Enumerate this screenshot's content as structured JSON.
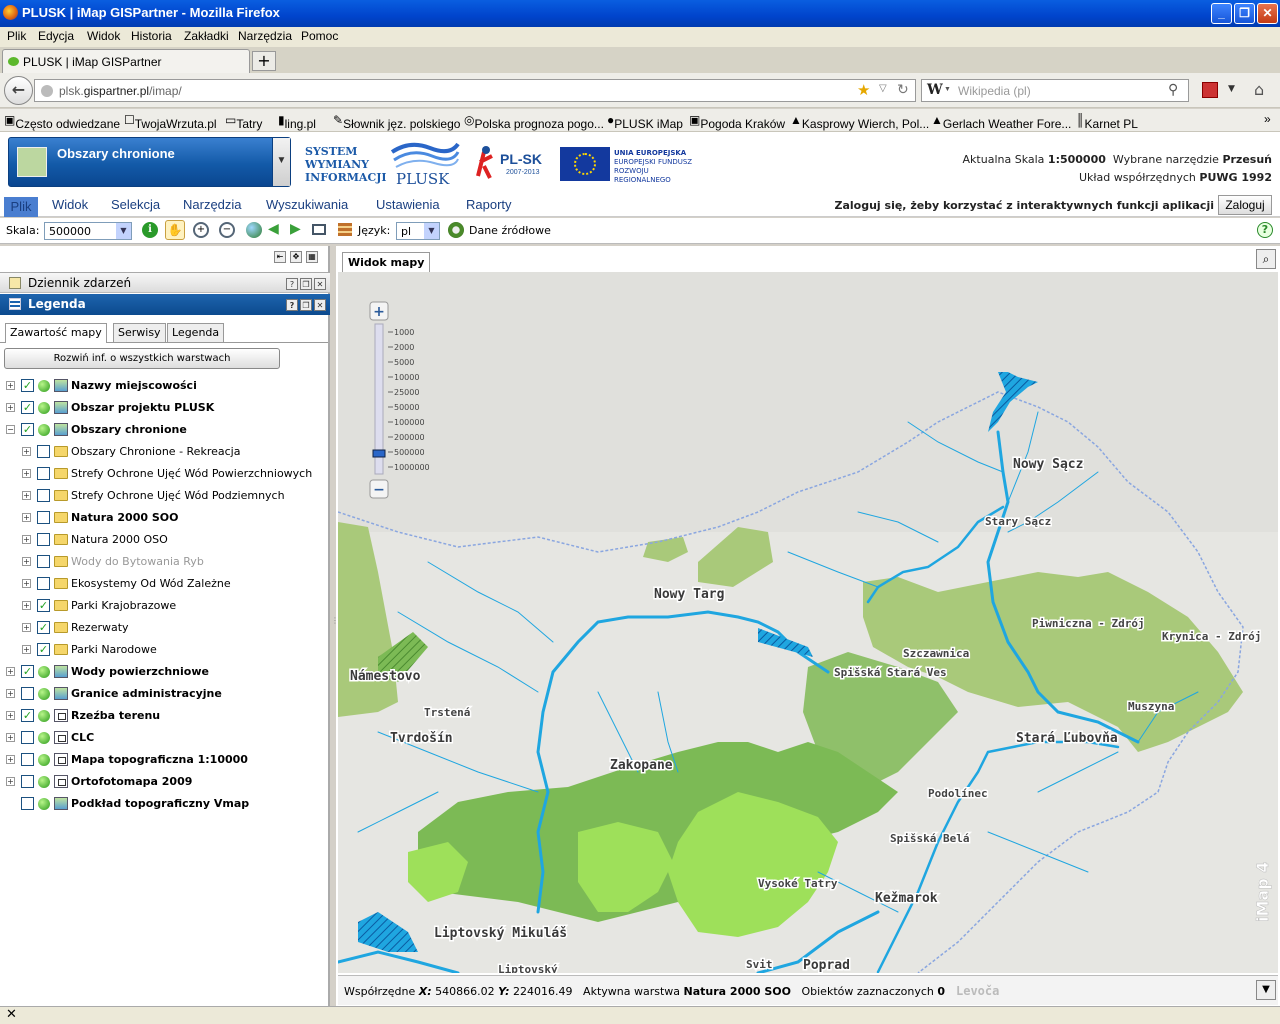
{
  "window": {
    "title": "PLUSK | iMap GISPartner - Mozilla Firefox",
    "controls": {
      "minimize": "_",
      "maximize": "❐",
      "close": "✕"
    }
  },
  "menubar": [
    "Plik",
    "Edycja",
    "Widok",
    "Historia",
    "Zakładki",
    "Narzędzia",
    "Pomoc"
  ],
  "browser_tab": {
    "label": "PLUSK | iMap GISPartner",
    "new_tab": "+"
  },
  "nav": {
    "url_host": "plsk.",
    "url_domain": "gispartner.pl",
    "url_path": "/imap/",
    "search_placeholder": "Wikipedia (pl)"
  },
  "bookmarks": [
    "Często odwiedzane",
    "TwojaWrzuta.pl",
    "Tatry",
    "ling.pl",
    "Słownik jęz. polskiego",
    "Polska prognoza pogo...",
    "PLUSK iMap",
    "Pogoda Kraków",
    "Kasprowy Wierch, Pol...",
    "Gerlach Weather Fore...",
    "Karnet PL"
  ],
  "app": {
    "area_selector": "Obszary chronione",
    "system_name": [
      "SYSTEM",
      "WYMIANY",
      "INFORMACJI"
    ],
    "plusk_logo_text": "PLUSK",
    "plsk_logo_text": "PL-SK",
    "plsk_years": "2007-2013",
    "eu_text": [
      "UNIA EUROPEJSKA",
      "EUROPEJSKI FUNDUSZ",
      "ROZWOJU REGIONALNEGO"
    ],
    "scale_label": "Aktualna Skala",
    "scale_value": "1:500000",
    "tool_label": "Wybrane narzędzie",
    "tool_value": "Przesuń",
    "crs_label": "Układ współrzędnych",
    "crs_value": "PUWG 1992"
  },
  "appmenu": [
    "Plik",
    "Widok",
    "Selekcja",
    "Narzędzia",
    "Wyszukiwania",
    "Ustawienia",
    "Raporty"
  ],
  "login": {
    "message": "Zaloguj się, żeby korzystać z interaktywnych funkcji aplikacji",
    "button": "Zaloguj"
  },
  "toolbar": {
    "scale_label": "Skala:",
    "scale_value": "500000",
    "lang_label": "Język:",
    "lang_value": "pl",
    "source_label": "Dane źródłowe"
  },
  "left_panel": {
    "events_title": "Dziennik zdarzeń",
    "legend_title": "Legenda",
    "subtabs": [
      "Zawartość mapy",
      "Serwisy",
      "Legenda"
    ],
    "expand_all": "Rozwiń inf. o wszystkich warstwach",
    "layers": [
      {
        "label": "Nazwy miejscowości",
        "checked": true,
        "bold": true,
        "level": 0,
        "icon": "layer"
      },
      {
        "label": "Obszar projektu PLUSK",
        "checked": true,
        "bold": true,
        "level": 0,
        "icon": "layer"
      },
      {
        "label": "Obszary chronione",
        "checked": true,
        "bold": true,
        "level": 0,
        "icon": "layer",
        "expanded": true
      },
      {
        "label": "Obszary Chronione - Rekreacja",
        "checked": false,
        "bold": false,
        "level": 1,
        "icon": "folder"
      },
      {
        "label": "Strefy Ochrone Ujęć Wód Powierzchniowych",
        "checked": false,
        "bold": false,
        "level": 1,
        "icon": "folder"
      },
      {
        "label": "Strefy Ochrone Ujęć Wód Podziemnych",
        "checked": false,
        "bold": false,
        "level": 1,
        "icon": "folder"
      },
      {
        "label": "Natura 2000 SOO",
        "checked": false,
        "bold": true,
        "level": 1,
        "icon": "folder"
      },
      {
        "label": "Natura 2000 OSO",
        "checked": false,
        "bold": false,
        "level": 1,
        "icon": "folder"
      },
      {
        "label": "Wody do Bytowania Ryb",
        "checked": false,
        "bold": false,
        "level": 1,
        "icon": "folder",
        "dim": true
      },
      {
        "label": "Ekosystemy Od Wód Zależne",
        "checked": false,
        "bold": false,
        "level": 1,
        "icon": "folder"
      },
      {
        "label": "Parki Krajobrazowe",
        "checked": true,
        "bold": false,
        "level": 1,
        "icon": "folder"
      },
      {
        "label": "Rezerwaty",
        "checked": true,
        "bold": false,
        "level": 1,
        "icon": "folder"
      },
      {
        "label": "Parki Narodowe",
        "checked": true,
        "bold": false,
        "level": 1,
        "icon": "folder"
      },
      {
        "label": "Wody powierzchniowe",
        "checked": true,
        "bold": true,
        "level": 0,
        "icon": "layer"
      },
      {
        "label": "Granice administracyjne",
        "checked": false,
        "bold": true,
        "level": 0,
        "icon": "layer"
      },
      {
        "label": "Rzeźba terenu",
        "checked": true,
        "bold": true,
        "level": 0,
        "icon": "grid"
      },
      {
        "label": "CLC",
        "checked": false,
        "bold": true,
        "level": 0,
        "icon": "grid"
      },
      {
        "label": "Mapa topograficzna 1:10000",
        "checked": false,
        "bold": true,
        "level": 0,
        "icon": "grid"
      },
      {
        "label": "Ortofotomapa 2009",
        "checked": false,
        "bold": true,
        "level": 0,
        "icon": "grid"
      },
      {
        "label": "Podkład topograficzny Vmap",
        "checked": false,
        "bold": true,
        "level": 0,
        "icon": "layer",
        "noexpand": true
      }
    ]
  },
  "map": {
    "tab": "Widok mapy",
    "zoom_in": "+",
    "zoom_out": "−",
    "zoom_levels": [
      "1000",
      "2000",
      "5000",
      "10000",
      "25000",
      "50000",
      "100000",
      "200000",
      "500000",
      "1000000"
    ],
    "zoom_level_selected": "500000",
    "watermark": "iMap 4",
    "towns": [
      "Nowy Sącz",
      "Stary Sącz",
      "Nowy Targ",
      "Szczawnica",
      "Piwniczna - Zdrój",
      "Krynica - Zdrój",
      "Spišská Stará Ves",
      "Námestovo",
      "Trstená",
      "Tvrdošín",
      "Muszyna",
      "Zakopane",
      "Stará Ľubovňa",
      "Podolínec",
      "Spišská Belá",
      "Vysoké Tatry",
      "Kežmarok",
      "Liptovský Mikuláš",
      "Liptovský",
      "Svit",
      "Poprad",
      "Levoča"
    ],
    "colors": {
      "park_light": "#a9c97a",
      "park_dark": "#7cba55",
      "park_bright": "#9ee05a",
      "water": "#1fa6e0",
      "background": "#eaeae6"
    }
  },
  "status": {
    "coords_label": "Współrzędne",
    "x_label": "X:",
    "x_value": "540866.02",
    "y_label": "Y:",
    "y_value": "224016.49",
    "active_label": "Aktywna warstwa",
    "active_value": "Natura 2000 SOO",
    "selected_label": "Obiektów zaznaczonych",
    "selected_value": "0"
  },
  "browser_status": "✕"
}
